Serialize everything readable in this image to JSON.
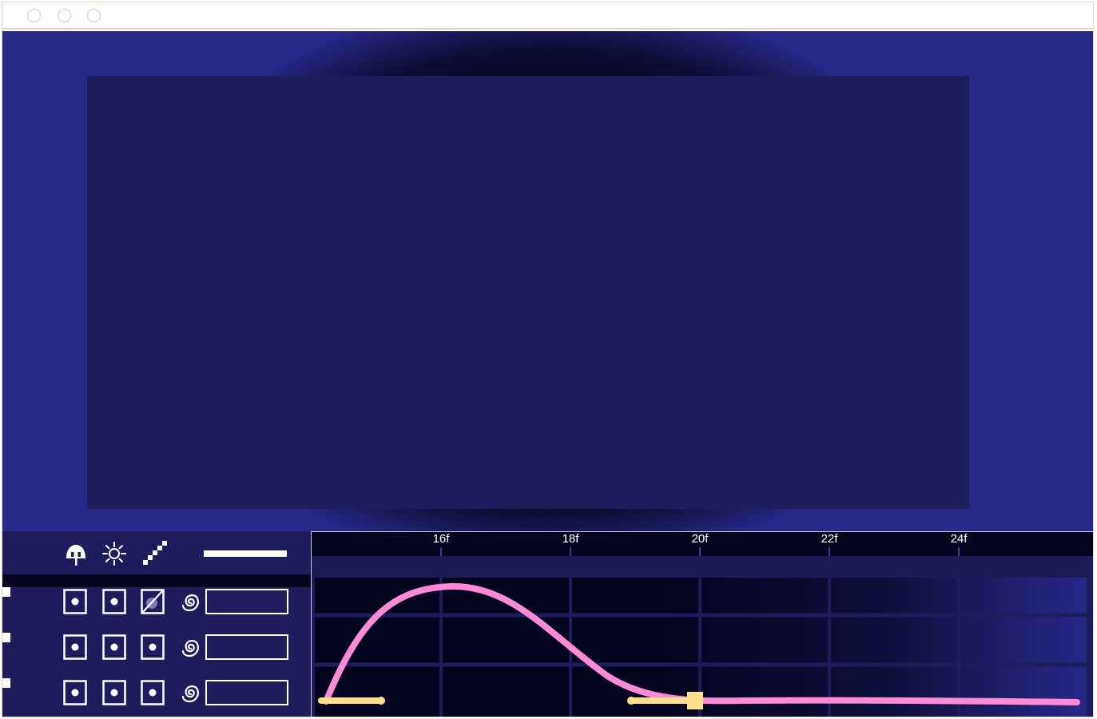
{
  "window": {
    "controls": [
      "close",
      "minimize",
      "zoom"
    ]
  },
  "colors": {
    "stage_background": "#282889",
    "canvas": "#1e1c5c",
    "panel": "#1e1c5c",
    "track_dark": "#05051f",
    "curve": "#ff8ad8",
    "handle": "#ffe08a",
    "icon": "#ffffff"
  },
  "toolbar": {
    "icons": [
      "ghost-icon",
      "sun-icon",
      "stairs-icon"
    ],
    "opacity_slider_value": 1.0
  },
  "layers": [
    {
      "icons": [
        "visibility-toggle-icon",
        "lock-toggle-icon",
        "onion-skin-off-icon",
        "spiral-icon"
      ],
      "name": ""
    },
    {
      "icons": [
        "visibility-toggle-icon",
        "lock-toggle-icon",
        "onion-skin-toggle-icon",
        "spiral-icon"
      ],
      "name": ""
    },
    {
      "icons": [
        "visibility-toggle-icon",
        "lock-toggle-icon",
        "onion-skin-toggle-icon",
        "spiral-icon"
      ],
      "name": ""
    }
  ],
  "timeline": {
    "frame_labels": [
      "16f",
      "18f",
      "20f",
      "22f",
      "24f"
    ]
  }
}
